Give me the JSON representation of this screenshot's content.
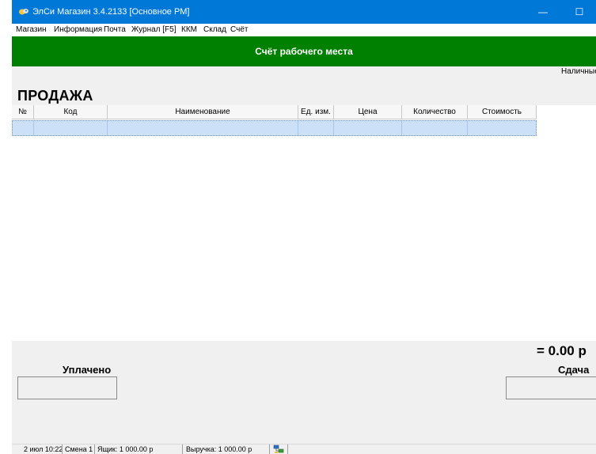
{
  "window": {
    "title": "ЭлСи Магазин 3.4.2133 [Основное РМ]",
    "controls": {
      "minimize": "—",
      "maximize": "☐",
      "close": "✕"
    }
  },
  "menu": [
    "Магазин",
    "Информация",
    "Почта",
    "Журнал [F5]",
    "ККМ",
    "Склад",
    "Счёт"
  ],
  "banner": {
    "title": "Счёт рабочего места"
  },
  "payment_type": "Наличные",
  "section_title": "ПРОДАЖА",
  "table": {
    "columns": [
      "№",
      "Код",
      "Наименование",
      "Ед. изм.",
      "Цена",
      "Количество",
      "Стоимость"
    ],
    "rows": [
      [
        "",
        "",
        "",
        "",
        "",
        "",
        ""
      ]
    ]
  },
  "totals": {
    "total": "= 0.00 р",
    "paid_label": "Уплачено",
    "paid_value": "",
    "change_label": "Сдача",
    "change_value": ""
  },
  "status": {
    "datetime": "2 июл 10:22",
    "shift": "Смена 1",
    "drawer": "Ящик: 1 000.00 р",
    "revenue": "Выручка: 1 000.00 р"
  },
  "colors": {
    "titlebar": "#0078d7",
    "banner": "#008000",
    "selected_row": "#cce0f7"
  }
}
